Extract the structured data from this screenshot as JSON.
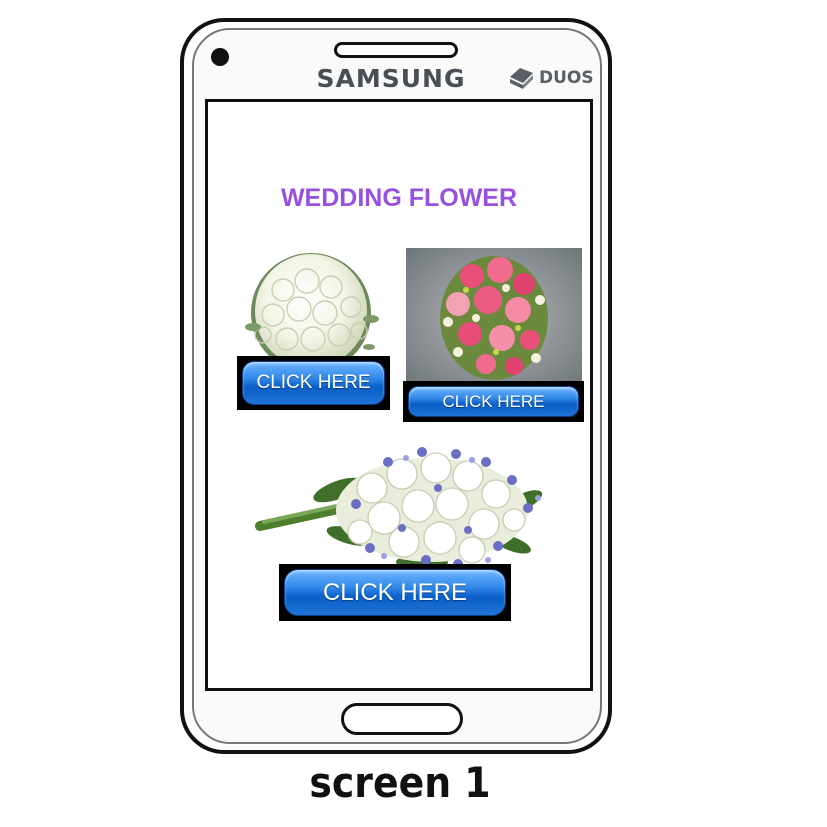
{
  "device": {
    "brand": "SAMSUNG",
    "badge": "DUOS",
    "caption": "screen 1"
  },
  "app": {
    "title": "WEDDING FLOWER",
    "title_color": "#9651e0",
    "cards": [
      {
        "image": "white-rose-bouquet",
        "button_label": "CLICK HERE"
      },
      {
        "image": "pink-peony-bouquet",
        "button_label": "CLICK HERE"
      },
      {
        "image": "white-rose-blue-bouquet",
        "button_label": "CLICK HERE"
      }
    ]
  },
  "colors": {
    "button_blue": "#1f74d8",
    "phone_outline": "#111111"
  }
}
